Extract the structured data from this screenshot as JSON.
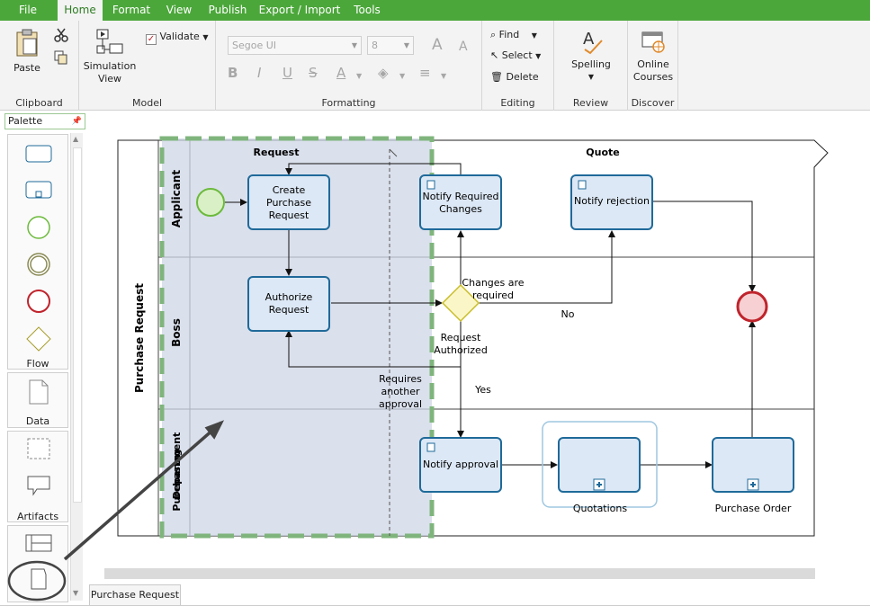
{
  "menu": {
    "tabs": [
      {
        "label": "File"
      },
      {
        "label": "Home"
      },
      {
        "label": "Format"
      },
      {
        "label": "View"
      },
      {
        "label": "Publish"
      },
      {
        "label": "Export / Import"
      },
      {
        "label": "Tools"
      }
    ]
  },
  "ribbon": {
    "clipboard": {
      "label": "Clipboard",
      "paste": "Paste"
    },
    "model": {
      "label": "Model",
      "simulation": "Simulation View",
      "validate": "Validate"
    },
    "formatting": {
      "label": "Formatting",
      "font": "Segoe UI",
      "size": "8"
    },
    "editing": {
      "label": "Editing",
      "find": "Find",
      "select": "Select",
      "delete": "Delete"
    },
    "review": {
      "label": "Review",
      "spelling": "Spelling"
    },
    "discover": {
      "label": "Discover",
      "online": "Online Courses"
    }
  },
  "palette": {
    "title": "Palette",
    "sections": [
      {
        "label": "Flow"
      },
      {
        "label": "Data"
      },
      {
        "label": "Artifacts"
      }
    ]
  },
  "diagram": {
    "pool": "Purchase Request",
    "lanes": [
      "Applicant",
      "Boss",
      "Purchasing Department"
    ],
    "phases": [
      "Request",
      "Quote"
    ],
    "tasks": {
      "create": "Create Purchase Request",
      "authorize": "Authorize Request",
      "notify_changes": "Notify Required Changes",
      "notify_rejection": "Notify rejection",
      "notify_approval": "Notify approval",
      "quotations": "Quotations",
      "purchase_order": "Purchase Order"
    },
    "gateway": "Request Authorized",
    "flow_labels": {
      "changes": "Changes are required",
      "no": "No",
      "yes": "Yes",
      "another": "Requires another approval"
    }
  },
  "bottom_tab": "Purchase Request",
  "colors": {
    "accent": "#4ca73b",
    "task_fill": "#dce8f5",
    "task_stroke": "#1f6a9a",
    "start_event": "#6cba3c",
    "end_event": "#c0242c",
    "gateway": "#e4df45",
    "selection": "#7fb57c"
  }
}
